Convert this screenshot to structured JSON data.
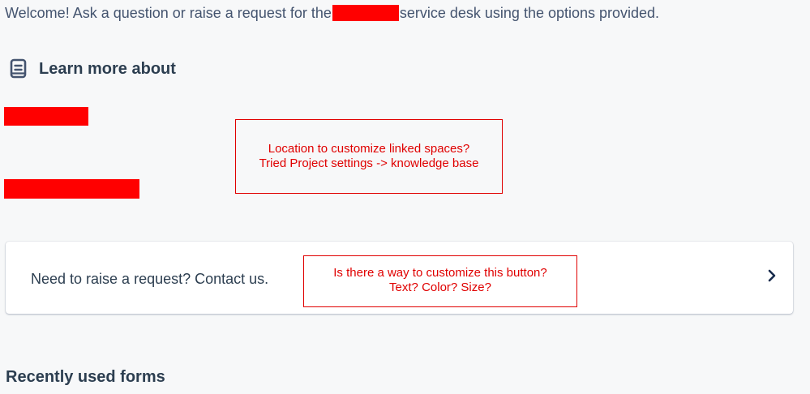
{
  "welcome": {
    "prefix": "Welcome! Ask a question or raise a request for the",
    "suffix": "service desk using the options provided."
  },
  "learn_more": {
    "icon": "book-icon",
    "title": "Learn more about"
  },
  "annotations": {
    "linked_spaces": {
      "line1": "Location to customize linked spaces?",
      "line2": "Tried Project settings -> knowledge base"
    },
    "button": {
      "line1": "Is there a way to customize this button?",
      "line2": "Text? Color? Size?"
    }
  },
  "request_card": {
    "label": "Need to raise a request? Contact us.",
    "icon": "chevron-right-icon"
  },
  "recent_forms": {
    "title": "Recently used forms"
  },
  "colors": {
    "redaction": "#ff0000",
    "annotation": "#e00000",
    "background": "#f7f8f9",
    "card": "#ffffff",
    "text": "#172b4d"
  }
}
